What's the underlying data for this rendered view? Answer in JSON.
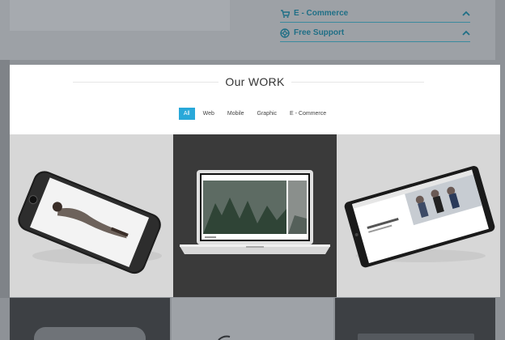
{
  "support_menu": {
    "items": [
      {
        "label": "E - Commerce",
        "icon": "cart-icon"
      },
      {
        "label": "Free Support",
        "icon": "lifebuoy-icon"
      }
    ],
    "accent_color": "#1f6f86"
  },
  "work": {
    "title": "Our WORK",
    "filters": [
      "All",
      "Web",
      "Mobile",
      "Graphic",
      "E - Commerce"
    ],
    "active_filter": "All",
    "accent_color": "#29a8d9"
  },
  "portfolio": {
    "items": [
      {
        "device": "phone-mockup"
      },
      {
        "device": "laptop-mockup"
      },
      {
        "device": "tablet-mockup"
      }
    ]
  }
}
